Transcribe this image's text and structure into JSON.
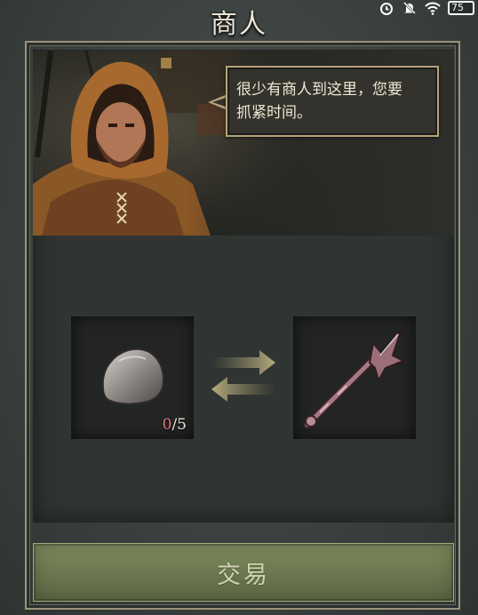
{
  "status_bar": {
    "icons": [
      "alarm-clock-icon",
      "notifications-off-icon",
      "wifi-icon"
    ],
    "battery": "75"
  },
  "title": "商人",
  "dialog": {
    "speaker_icon": "hooded-merchant-portrait",
    "text_line1": "很少有商人到这里，您要",
    "text_line2": "抓紧时间。"
  },
  "trade": {
    "give_item": {
      "icon": "stone-icon",
      "have": "0",
      "need": "/5"
    },
    "exchange_icon": "swap-arrows-icon",
    "receive_item": {
      "icon": "spiked-mace-icon"
    }
  },
  "button": {
    "label": "交易"
  },
  "colors": {
    "button_green": "#6c7850",
    "frame_gold": "#9a9478",
    "count_red": "#e0787a"
  }
}
